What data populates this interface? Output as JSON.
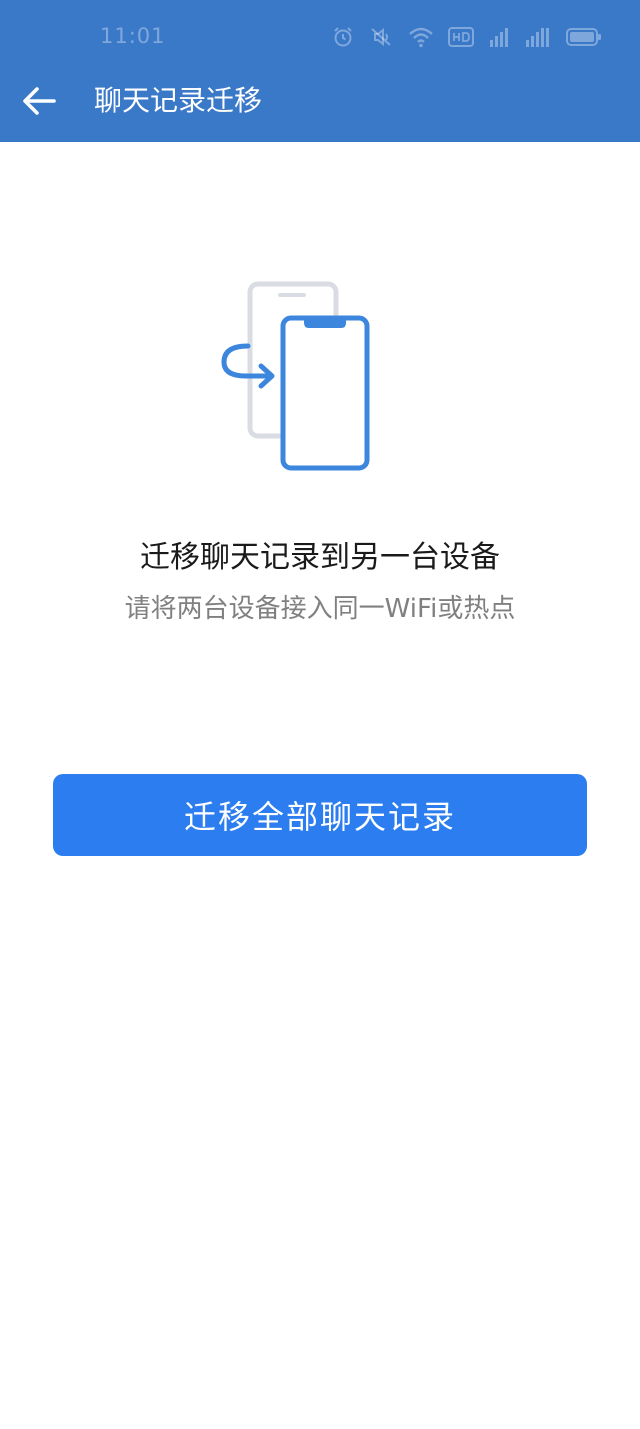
{
  "status_bar": {
    "time": "11:01",
    "icons": [
      "alarm-icon",
      "mute-icon",
      "wifi-icon",
      "hd-icon",
      "signal-4g-icon",
      "signal-5g-icon",
      "battery-icon"
    ]
  },
  "header": {
    "back_icon": "arrow-left-icon",
    "title": "聊天记录迁移"
  },
  "main": {
    "illustration": "phone-transfer-icon",
    "headline": "迁移聊天记录到另一台设备",
    "subline": "请将两台设备接入同一WiFi或热点",
    "primary_button_label": "迁移全部聊天记录"
  },
  "colors": {
    "header_bg": "#3a78c8",
    "button_bg": "#2c7ef0",
    "illustration_blue": "#3d86dd",
    "illustration_gray": "#d9dde3"
  }
}
